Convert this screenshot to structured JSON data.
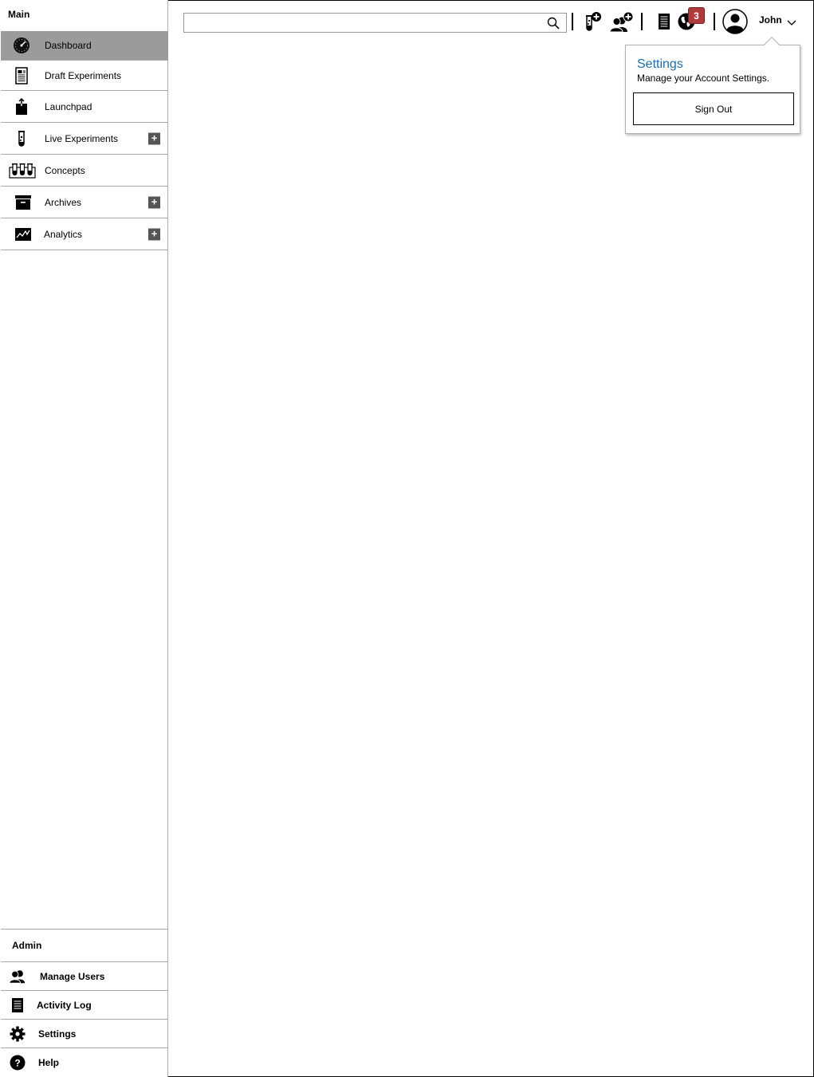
{
  "sidebar": {
    "main_header": "Main",
    "items": [
      {
        "label": "Dashboard",
        "icon": "dashboard-gauge-icon",
        "active": true
      },
      {
        "label": "Draft Experiments",
        "icon": "document-icon"
      },
      {
        "label": "Launchpad",
        "icon": "launch-box-icon"
      },
      {
        "label": "Live Experiments",
        "icon": "test-tube-icon",
        "expandable": true
      },
      {
        "label": "Concepts",
        "icon": "test-tube-rack-icon"
      },
      {
        "label": "Archives",
        "icon": "archive-box-icon",
        "expandable": true
      },
      {
        "label": "Analytics",
        "icon": "analytics-chart-icon",
        "expandable": true
      }
    ],
    "expand_symbol": "+",
    "admin_header": "Admin",
    "admin_items": [
      {
        "label": "Manage Users",
        "icon": "users-icon"
      },
      {
        "label": "Activity Log",
        "icon": "log-document-icon"
      },
      {
        "label": "Settings",
        "icon": "gear-icon"
      },
      {
        "label": "Help",
        "icon": "help-icon"
      }
    ]
  },
  "topbar": {
    "search": {
      "value": "",
      "placeholder": "",
      "icon": "search-icon"
    },
    "actions": [
      "add-experiment-icon",
      "add-user-icon",
      "document-icon",
      "globe-notifications-icon"
    ],
    "notification_count": "3",
    "user": {
      "name": "John",
      "avatar": "user-avatar-icon"
    }
  },
  "dropdown": {
    "title": "Settings",
    "subtitle": "Manage your Account Settings.",
    "sign_out": "Sign Out"
  },
  "colors": {
    "active_nav": "#9b9b9b",
    "badge": "#b03a3a",
    "link": "#1a6fb5"
  }
}
